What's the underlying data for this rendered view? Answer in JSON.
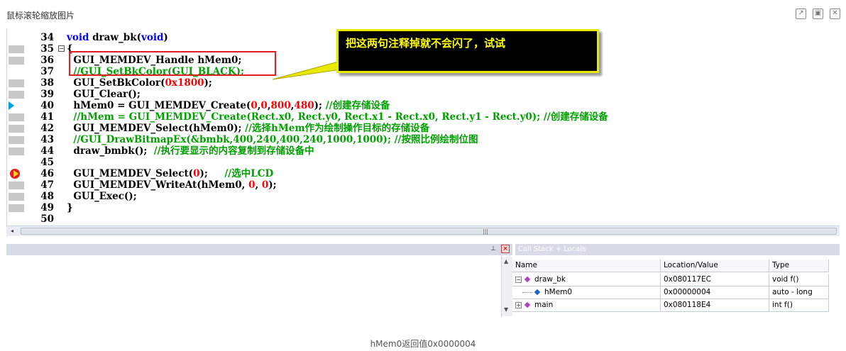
{
  "viewer": {
    "title": "鼠标滚轮缩放图片",
    "buttons": {
      "popout": "↗",
      "maximize": "▣",
      "close": "✕"
    }
  },
  "editor": {
    "lines": [
      {
        "num": "34",
        "parts": [
          [
            "kw",
            "void"
          ],
          [
            "t",
            " draw_bk("
          ],
          [
            "kw",
            "void"
          ],
          [
            "t",
            ")"
          ]
        ]
      },
      {
        "num": "35",
        "parts": [
          [
            "t",
            "{"
          ]
        ],
        "fold": "−"
      },
      {
        "num": "36",
        "parts": [
          [
            "t",
            "  GUI_MEMDEV_Handle hMem0;"
          ]
        ]
      },
      {
        "num": "37",
        "parts": [
          [
            "cm",
            "  //GUI_SetBkColor(GUI_BLACK);"
          ]
        ]
      },
      {
        "num": "38",
        "parts": [
          [
            "t",
            "  GUI_SetBkColor("
          ],
          [
            "num",
            "0x1800"
          ],
          [
            "t",
            ");"
          ]
        ]
      },
      {
        "num": "39",
        "parts": [
          [
            "t",
            "  GUI_Clear();"
          ]
        ]
      },
      {
        "num": "40",
        "parts": [
          [
            "t",
            "  hMem0 = GUI_MEMDEV_Create("
          ],
          [
            "num",
            "0"
          ],
          [
            "t",
            ","
          ],
          [
            "num",
            "0"
          ],
          [
            "t",
            ","
          ],
          [
            "num",
            "800"
          ],
          [
            "t",
            ","
          ],
          [
            "num",
            "480"
          ],
          [
            "t",
            "); "
          ],
          [
            "cm",
            "//创建存储设备"
          ]
        ],
        "marker": "arrow"
      },
      {
        "num": "41",
        "parts": [
          [
            "cm",
            "  //hMem = GUI_MEMDEV_Create(Rect.x0, Rect.y0, Rect.x1 - Rect.x0, Rect.y1 - Rect.y0); //创建存储设备"
          ]
        ]
      },
      {
        "num": "42",
        "parts": [
          [
            "t",
            "  GUI_MEMDEV_Select(hMem0); "
          ],
          [
            "cm",
            "//选择hMem作为绘制操作目标的存储设备"
          ]
        ]
      },
      {
        "num": "43",
        "parts": [
          [
            "cm",
            "  //GUI_DrawBitmapEx(&bmbk,400,240,400,240,1000,1000); //按照比例绘制位图"
          ]
        ]
      },
      {
        "num": "44",
        "parts": [
          [
            "t",
            "  draw_bmbk();  "
          ],
          [
            "cm",
            "//执行要显示的内容复制到存储设备中"
          ]
        ]
      },
      {
        "num": "45",
        "parts": []
      },
      {
        "num": "46",
        "parts": [
          [
            "t",
            "  GUI_MEMDEV_Select("
          ],
          [
            "num",
            "0"
          ],
          [
            "t",
            ");     "
          ],
          [
            "cm",
            "//选中LCD"
          ]
        ],
        "marker": "breakpoint"
      },
      {
        "num": "47",
        "parts": [
          [
            "t",
            "  GUI_MEMDEV_WriteAt(hMem0, "
          ],
          [
            "num",
            "0"
          ],
          [
            "t",
            ", "
          ],
          [
            "num",
            "0"
          ],
          [
            "t",
            ");"
          ]
        ]
      },
      {
        "num": "48",
        "parts": [
          [
            "t",
            "  GUI_Exec();"
          ]
        ]
      },
      {
        "num": "49",
        "parts": [
          [
            "t",
            "}"
          ]
        ]
      },
      {
        "num": "50",
        "parts": []
      }
    ],
    "callout_text": "把这两句注释掉就不会闪了，试试"
  },
  "lower": {
    "right_title": "Call Stack + Locals",
    "columns": [
      "Name",
      "Location/Value",
      "Type"
    ],
    "rows": [
      {
        "name": "draw_bk",
        "value": "0x080117EC",
        "type": "void f()"
      },
      {
        "name": "hMem0",
        "value": "0x00000004",
        "type": "auto - long"
      },
      {
        "name": "main",
        "value": "0x080118E4",
        "type": "int f()"
      }
    ]
  },
  "caption": "hMem0返回值0x0000004",
  "colors": {
    "keyword": "#0000ff",
    "number": "#ff0000",
    "comment": "#00a000",
    "callout_text": "#ffff00"
  }
}
